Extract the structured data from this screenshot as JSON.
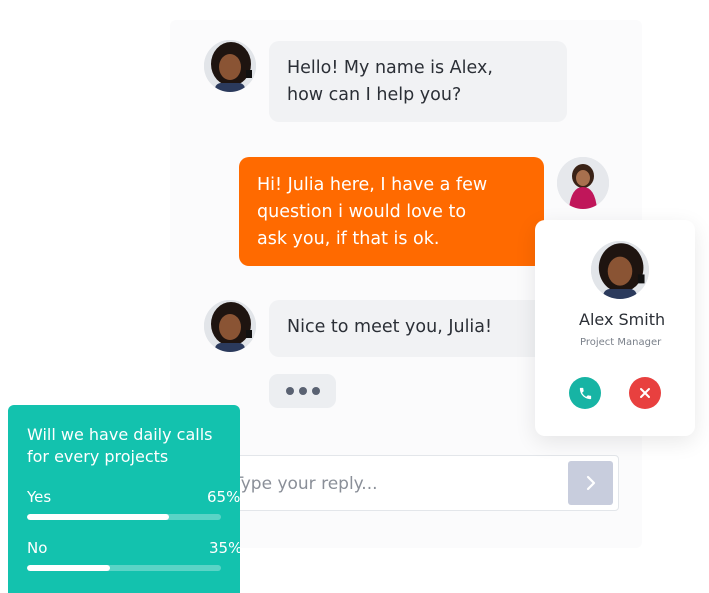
{
  "colors": {
    "accent_orange": "#ff6a00",
    "poll_teal": "#13c2ae",
    "call_green": "#17b4a4",
    "decline_red": "#e8403f"
  },
  "chat": {
    "messages": [
      {
        "sender": "agent",
        "lines": [
          "Hello! My name is Alex,",
          "how can I help you?"
        ]
      },
      {
        "sender": "user",
        "lines": [
          "Hi! Julia here, I have a few",
          "question i would love to",
          "ask you, if that is ok."
        ]
      },
      {
        "sender": "agent",
        "lines": [
          "Nice to meet you, Julia!"
        ]
      }
    ],
    "typing_icon": "typing-dots-icon"
  },
  "reply": {
    "placeholder": "Type your reply...",
    "send_icon": "chevron-right-icon"
  },
  "profile": {
    "name": "Alex Smith",
    "role": "Project Manager",
    "call_icon": "phone-icon",
    "decline_icon": "close-icon"
  },
  "poll": {
    "question": "Will we have daily calls for every projects",
    "options": [
      {
        "label": "Yes",
        "percent_text": "65%",
        "fraction": 0.73
      },
      {
        "label": "No",
        "percent_text": "35%",
        "fraction": 0.43
      }
    ]
  }
}
